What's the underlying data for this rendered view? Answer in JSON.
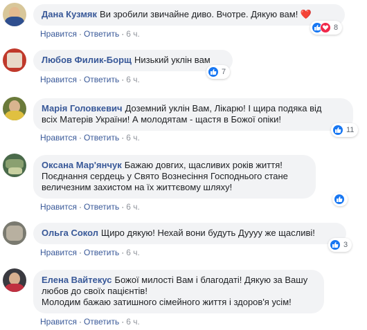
{
  "comments": [
    {
      "author": "Дана Кузмяк",
      "text_lines": [
        "Ви зробили звичайне диво. Вчотре. Дякую вам! ❤️"
      ],
      "like": "Нравится",
      "reply": "Ответить",
      "time": "6 ч.",
      "reaction_count": "8",
      "reactions": [
        "like-icon",
        "love-icon"
      ]
    },
    {
      "author": "Любов Филик-Борщ",
      "text_lines": [
        "Низький уклін вам"
      ],
      "like": "Нравится",
      "reply": "Ответить",
      "time": "6 ч.",
      "reaction_count": "7",
      "reactions": [
        "like-icon"
      ]
    },
    {
      "author": "Марія Головкевич",
      "text_lines": [
        "Доземний уклін Вам, Лікарю! І щира подяка від",
        "всіх Матерів України! А молодятам - щастя в Божої опіки!"
      ],
      "like": "Нравится",
      "reply": "Ответить",
      "time": "6 ч.",
      "reaction_count": "11",
      "reactions": [
        "like-icon"
      ]
    },
    {
      "author": "Оксана Мар'янчук",
      "text_lines": [
        "Бажаю довгих, щасливих років життя!",
        "Поєднання сердець у Свято Вознесіння Господнього стане",
        "величезним захистом на їх життєвому шляху!"
      ],
      "like": "Нравится",
      "reply": "Ответить",
      "time": "6 ч.",
      "reaction_count": "",
      "reactions": [
        "like-icon"
      ]
    },
    {
      "author": "Ольга Сокол",
      "text_lines": [
        "Щиро дякую! Нехай вони будуть Дуууу же щасливі!"
      ],
      "like": "Нравится",
      "reply": "Ответить",
      "time": "6 ч.",
      "reaction_count": "3",
      "reactions": [
        "like-icon"
      ]
    },
    {
      "author": "Елена Вайтекус",
      "text_lines": [
        "Божої милості Вам і благодаті! Дякую за Вашу",
        "любов до своїх пацієнтів!",
        "Молодим бажаю затишного сімейного життя і здоров'я усім!"
      ],
      "like": "Нравится",
      "reply": "Ответить",
      "time": "6 ч.",
      "reaction_count": "",
      "reactions": []
    }
  ],
  "colors": {
    "link": "#385898",
    "bubble": "#f2f3f5",
    "like": "#1877f2",
    "love": "#f0284a"
  }
}
